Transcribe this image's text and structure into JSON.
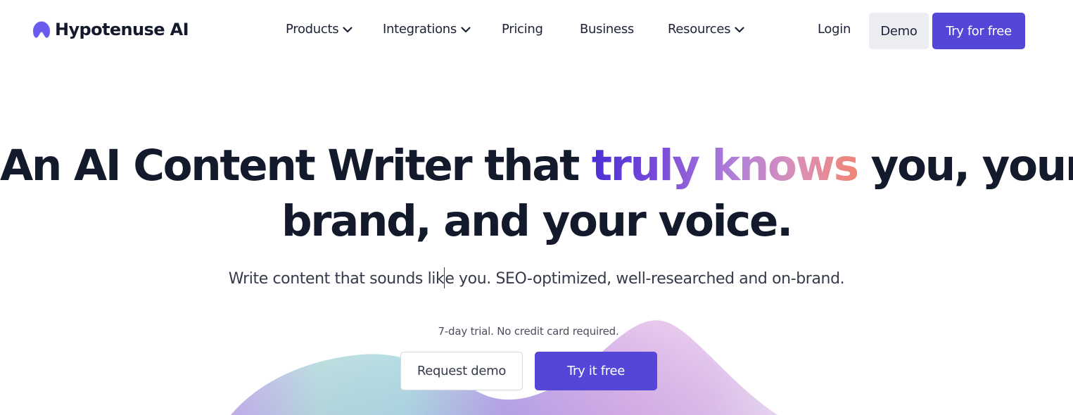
{
  "brand": {
    "name": "Hypotenuse AI",
    "logo_icon": "hypotenuse-logo-icon",
    "logo_color": "#6b5cf0"
  },
  "nav": {
    "items": [
      {
        "label": "Products",
        "has_dropdown": true,
        "icon": "chevron-down-icon"
      },
      {
        "label": "Integrations",
        "has_dropdown": true,
        "icon": "chevron-down-icon"
      },
      {
        "label": "Pricing",
        "has_dropdown": false
      },
      {
        "label": "Business",
        "has_dropdown": false
      },
      {
        "label": "Resources",
        "has_dropdown": true,
        "icon": "chevron-down-icon"
      }
    ],
    "login_label": "Login",
    "demo_label": "Demo",
    "try_free_label": "Try for free"
  },
  "hero": {
    "title_part1": "An AI Content Writer that ",
    "title_highlight": "truly knows",
    "title_part2": " you, your",
    "title_line2": "brand, and your voice.",
    "subtitle_before_caret": "Write content that sounds lik",
    "subtitle_after_caret": "e you. SEO-optimized, well-researched and on-brand.",
    "trial_note": "7-day trial. No credit card required.",
    "request_demo_label": "Request demo",
    "try_it_free_label": "Try it free"
  },
  "colors": {
    "accent": "#5447d8",
    "text_dark": "#131a2b",
    "demo_button_bg": "#ebedf1",
    "highlight_gradient": [
      "#4b30d6",
      "#b481d8",
      "#f08474"
    ]
  }
}
